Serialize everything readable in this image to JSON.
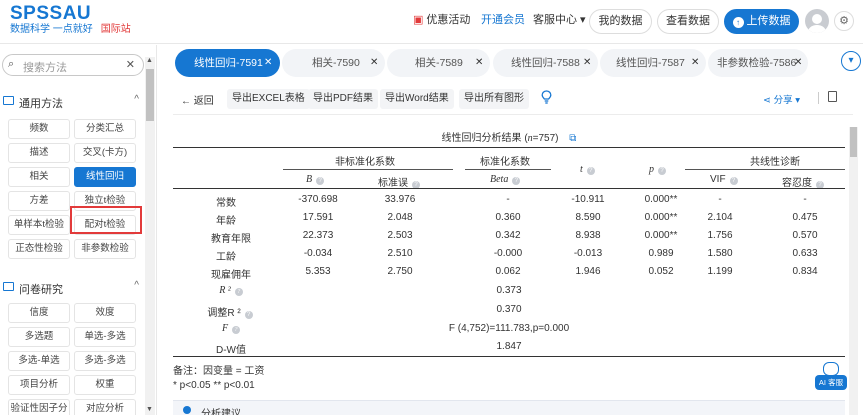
{
  "header": {
    "logo": "SPSSAU",
    "slogan": "数据科学 一点就好",
    "intl": "国际站",
    "promo": "优惠活动",
    "member": "开通会员",
    "support": "客服中心",
    "my_data": "我的数据",
    "view_data": "查看数据",
    "upload": "上传数据"
  },
  "sidebar": {
    "search_placeholder": "搜索方法",
    "groups": [
      {
        "title": "通用方法",
        "items": [
          "频数",
          "分类汇总",
          "描述",
          "交叉(卡方)",
          "相关",
          "线性回归",
          "方差",
          "独立t检验",
          "单样本t检验",
          "配对t检验",
          "正态性检验",
          "非参数检验"
        ]
      },
      {
        "title": "问卷研究",
        "items": [
          "信度",
          "效度",
          "多选题",
          "单选-多选",
          "多选-单选",
          "多选-多选",
          "项目分析",
          "权重",
          "验证性因子分",
          "对应分析"
        ]
      }
    ]
  },
  "tabs": [
    {
      "label": "线性回归-7591",
      "active": true
    },
    {
      "label": "相关-7590",
      "active": false
    },
    {
      "label": "相关-7589",
      "active": false
    },
    {
      "label": "线性回归-7588",
      "active": false
    },
    {
      "label": "线性回归-7587",
      "active": false
    },
    {
      "label": "非参数检验-7586",
      "active": false
    }
  ],
  "toolbar": {
    "back": "返回",
    "export_excel": "导出EXCEL表格",
    "export_pdf": "导出PDF结果",
    "export_word": "导出Word结果",
    "export_all_figures": "导出所有图形",
    "share": "分享"
  },
  "table": {
    "title_prefix": "线性回归分析结果 (",
    "title_n": "n",
    "title_suffix": "=757)",
    "group_headers": {
      "unstd": "非标准化系数",
      "std": "标准化系数",
      "collinearity": "共线性诊断"
    },
    "col_headers": {
      "B": "B",
      "se": "标准误",
      "beta": "Beta",
      "t": "t",
      "p": "p",
      "vif": "VIF",
      "tolerance": "容忍度"
    },
    "rows": [
      {
        "name": "常数",
        "B": "-370.698",
        "se": "33.976",
        "beta": "-",
        "t": "-10.911",
        "p": "0.000**",
        "vif": "-",
        "tol": "-"
      },
      {
        "name": "年龄",
        "B": "17.591",
        "se": "2.048",
        "beta": "0.360",
        "t": "8.590",
        "p": "0.000**",
        "vif": "2.104",
        "tol": "0.475"
      },
      {
        "name": "教育年限",
        "B": "22.373",
        "se": "2.503",
        "beta": "0.342",
        "t": "8.938",
        "p": "0.000**",
        "vif": "1.756",
        "tol": "0.570"
      },
      {
        "name": "工龄",
        "B": "-0.034",
        "se": "2.510",
        "beta": "-0.000",
        "t": "-0.013",
        "p": "0.989",
        "vif": "1.580",
        "tol": "0.633"
      },
      {
        "name": "现雇佣年",
        "B": "5.353",
        "se": "2.750",
        "beta": "0.062",
        "t": "1.946",
        "p": "0.052",
        "vif": "1.199",
        "tol": "0.834"
      }
    ],
    "summary": [
      {
        "label": "R ²",
        "value": "0.373"
      },
      {
        "label": "调整R ²",
        "value": "0.370"
      },
      {
        "label": "F",
        "value": "F (4,752)=111.783,p=0.000"
      },
      {
        "label": "D-W值",
        "value": "1.847"
      }
    ],
    "note_dv": "备注：因变量 = 工资",
    "note_sig": "* p<0.05 ** p<0.01"
  },
  "bottom_panel": {
    "label": "分析建议"
  },
  "ai_badge": "AI 客服",
  "colors": {
    "primary": "#1677d2",
    "highlight": "#e23a3a"
  }
}
